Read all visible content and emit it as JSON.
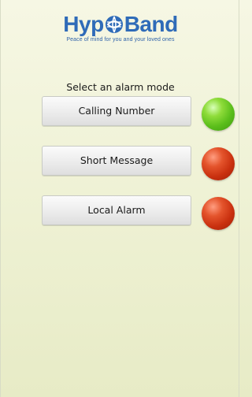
{
  "app": {
    "logo_part1": "Hyp",
    "logo_part2": "Band",
    "tagline": "Peace of mind for you and your loved ones"
  },
  "screen": {
    "prompt": "Select an alarm mode"
  },
  "modes": [
    {
      "label": "Calling Number",
      "status_color": "#5bbe1b",
      "indicator_icon": "status-dot-green"
    },
    {
      "label": "Short Message",
      "status_color": "#c9300f",
      "indicator_icon": "status-dot-red"
    },
    {
      "label": "Local Alarm",
      "status_color": "#c9300f",
      "indicator_icon": "status-dot-red"
    }
  ],
  "colors": {
    "brand_blue": "#2f6bb8",
    "background": "#eef1d3"
  }
}
